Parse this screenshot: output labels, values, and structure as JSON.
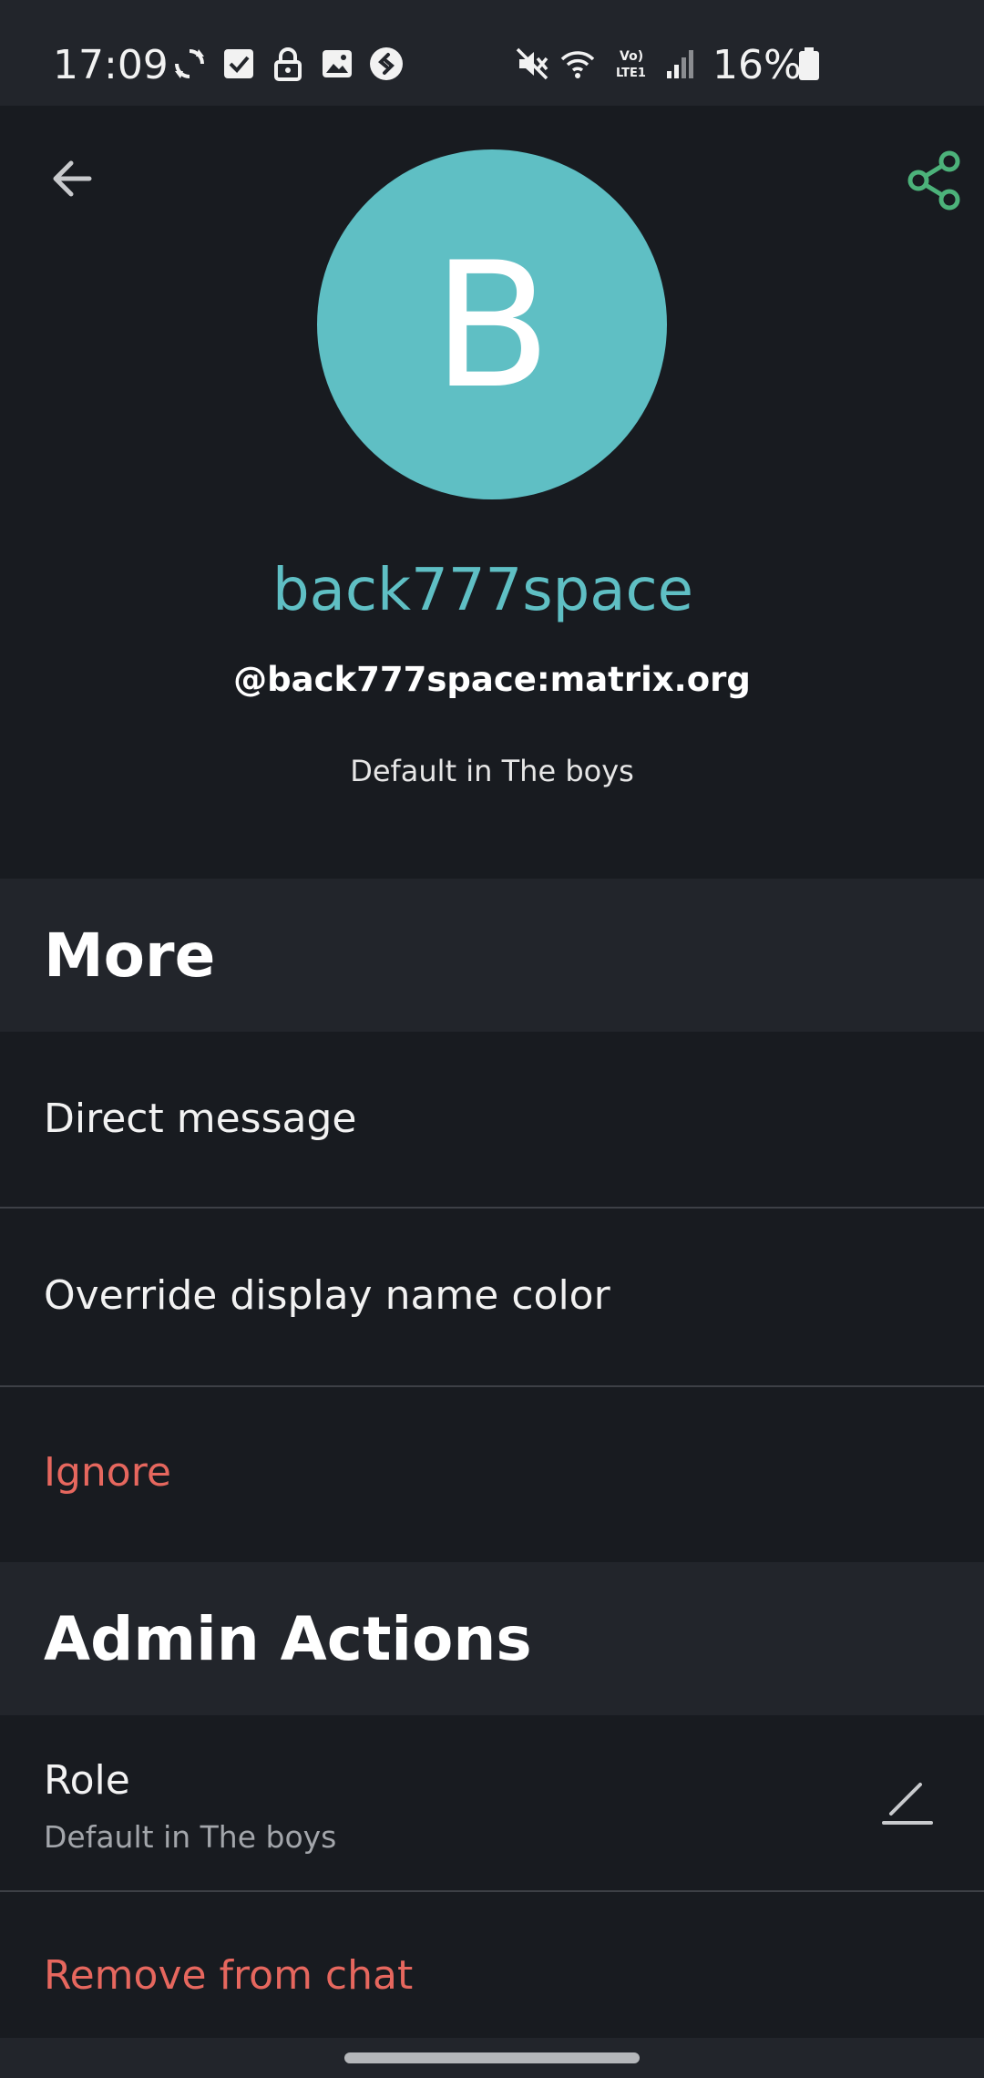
{
  "status_bar": {
    "time": "17:09",
    "battery_percent": "16%",
    "left_icons": [
      "sync-icon",
      "checkbox-icon",
      "lock-icon",
      "gallery-icon",
      "shazam-icon"
    ],
    "right_icons": [
      "mute-icon",
      "wifi-icon",
      "volte-icon",
      "signal-icon",
      "battery-icon"
    ]
  },
  "colors": {
    "background": "#181b20",
    "section_background": "#22252b",
    "accent": "#5fbfc4",
    "share_icon": "#4cb27a",
    "danger": "#e6675e"
  },
  "profile": {
    "avatar_letter": "B",
    "display_name": "back777space",
    "user_id": "@back777space:matrix.org",
    "role_caption": "Default in The boys"
  },
  "sections": {
    "more": {
      "title": "More",
      "items": [
        {
          "label": "Direct message"
        },
        {
          "label": "Override display name color"
        },
        {
          "label": "Ignore"
        }
      ]
    },
    "admin": {
      "title": "Admin Actions",
      "role": {
        "label": "Role",
        "value": "Default in The boys"
      },
      "remove_label": "Remove from chat"
    }
  }
}
